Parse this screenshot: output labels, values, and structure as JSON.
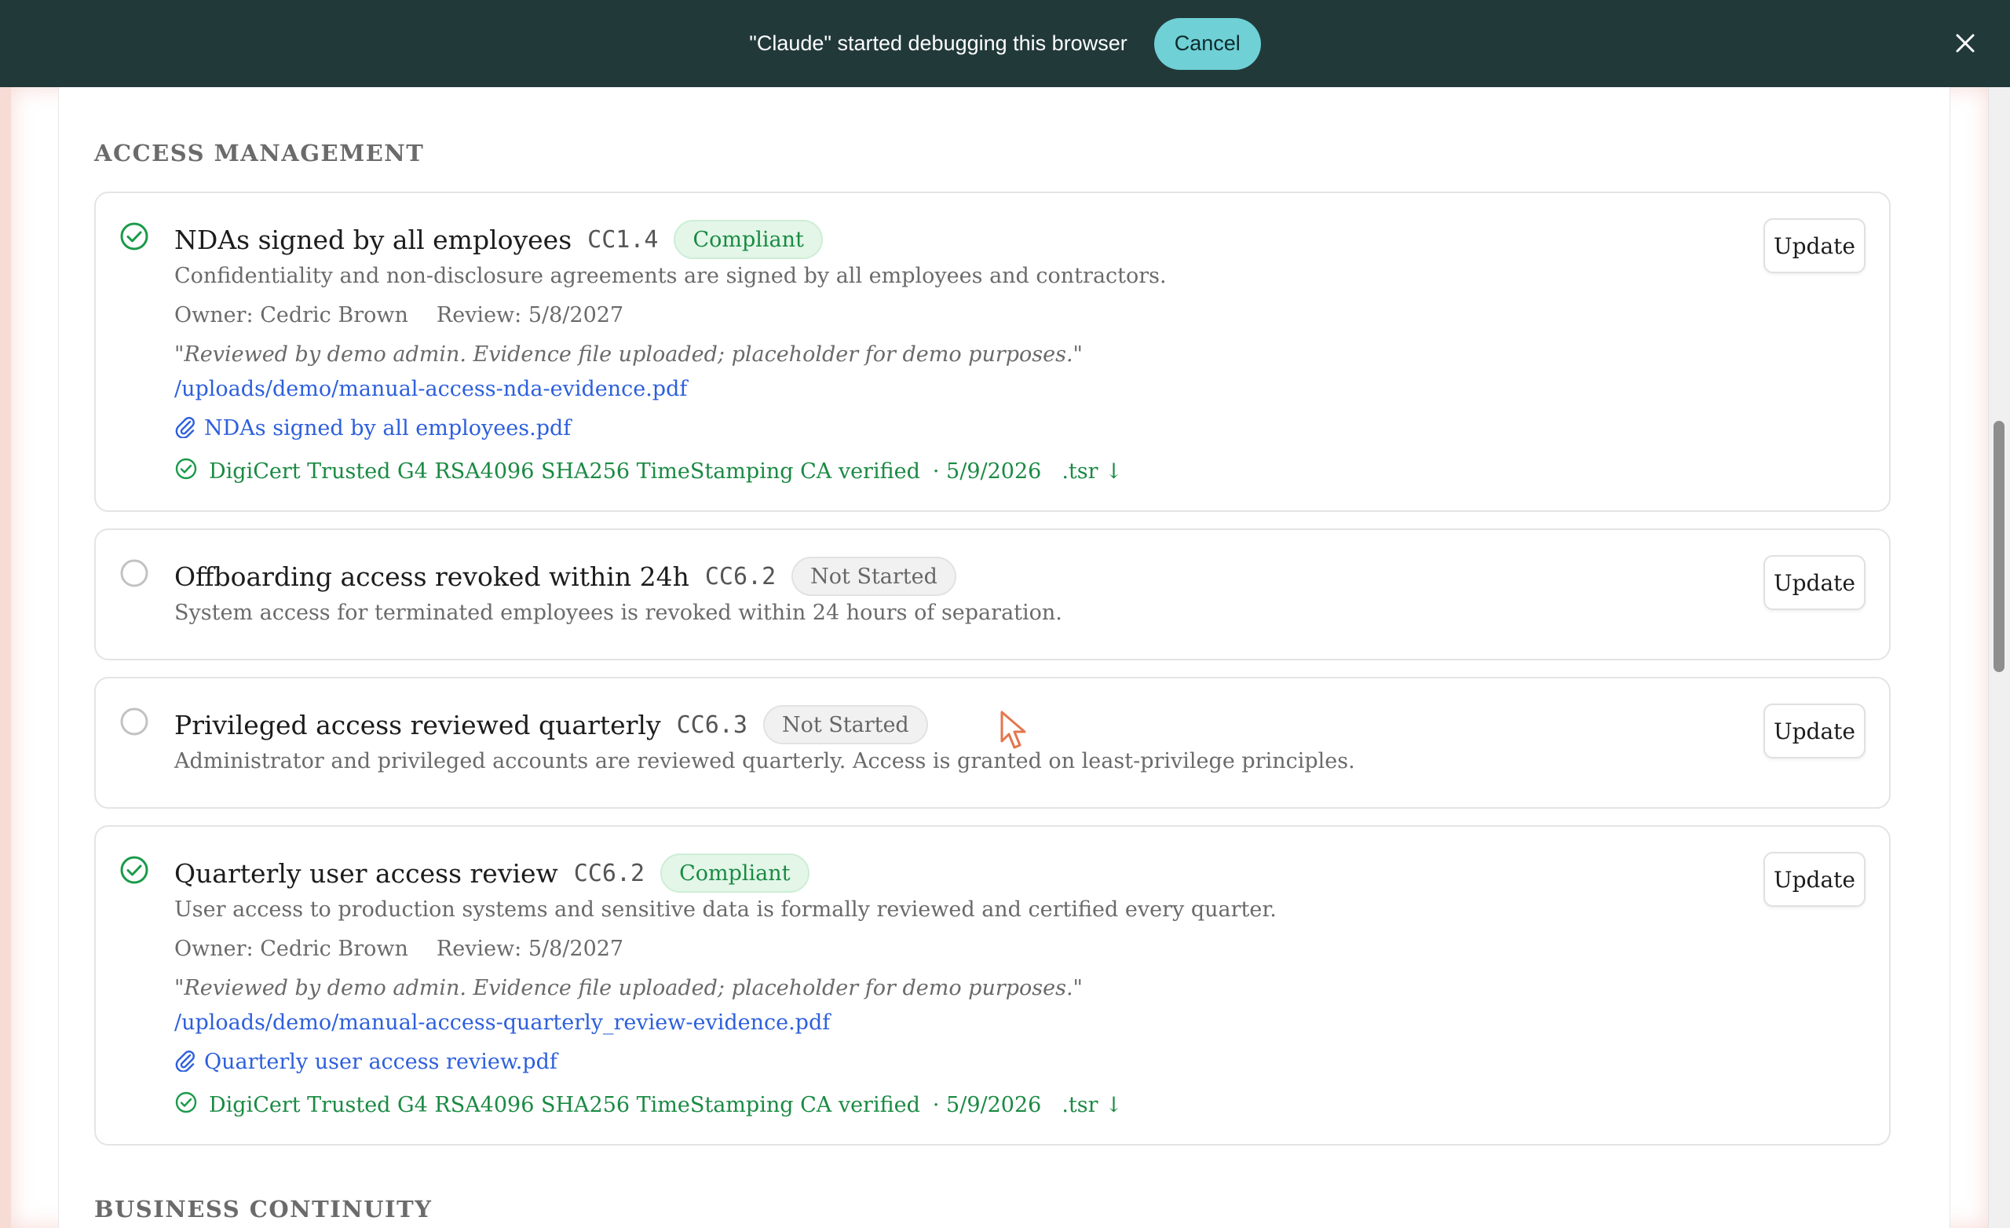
{
  "debug_bar": {
    "message": "\"Claude\" started debugging this browser",
    "cancel_label": "Cancel",
    "close_icon": "close-icon"
  },
  "sections": [
    {
      "heading": "ACCESS MANAGEMENT"
    },
    {
      "heading": "BUSINESS CONTINUITY"
    }
  ],
  "controls": [
    {
      "status": "compliant",
      "title": "NDAs signed by all employees",
      "code": "CC1.4",
      "badge": "Compliant",
      "description": "Confidentiality and non-disclosure agreements are signed by all employees and contractors.",
      "owner": "Owner: Cedric Brown",
      "review": "Review: 5/8/2027",
      "note": "\"Reviewed by demo admin. Evidence file uploaded; placeholder for demo purposes.\"",
      "path": "/uploads/demo/manual-access-nda-evidence.pdf",
      "attachment": "NDAs signed by all employees.pdf",
      "verification": "DigiCert Trusted G4 RSA4096 SHA256 TimeStamping CA verified",
      "verification_date": "· 5/9/2026",
      "tsr": ".tsr ↓",
      "update_label": "Update"
    },
    {
      "status": "not-started",
      "title": "Offboarding access revoked within 24h",
      "code": "CC6.2",
      "badge": "Not Started",
      "description": "System access for terminated employees is revoked within 24 hours of separation.",
      "update_label": "Update"
    },
    {
      "status": "not-started",
      "title": "Privileged access reviewed quarterly",
      "code": "CC6.3",
      "badge": "Not Started",
      "description": "Administrator and privileged accounts are reviewed quarterly. Access is granted on least-privilege principles.",
      "update_label": "Update"
    },
    {
      "status": "compliant",
      "title": "Quarterly user access review",
      "code": "CC6.2",
      "badge": "Compliant",
      "description": "User access to production systems and sensitive data is formally reviewed and certified every quarter.",
      "owner": "Owner: Cedric Brown",
      "review": "Review: 5/8/2027",
      "note": "\"Reviewed by demo admin. Evidence file uploaded; placeholder for demo purposes.\"",
      "path": "/uploads/demo/manual-access-quarterly_review-evidence.pdf",
      "attachment": "Quarterly user access review.pdf",
      "verification": "DigiCert Trusted G4 RSA4096 SHA256 TimeStamping CA verified",
      "verification_date": "· 5/9/2026",
      "tsr": ".tsr ↓",
      "update_label": "Update"
    }
  ],
  "colors": {
    "banner": "#22393a",
    "cancel": "#6fd0d6",
    "compliant": "#1a8a43",
    "link": "#2d5fdc"
  }
}
